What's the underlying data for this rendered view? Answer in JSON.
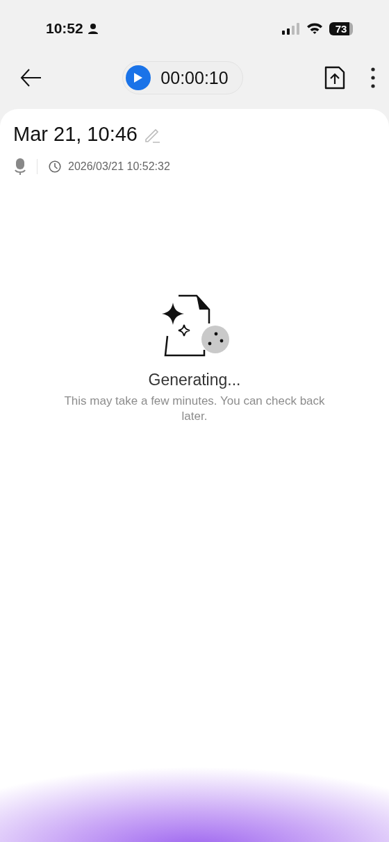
{
  "status_bar": {
    "time": "10:52",
    "battery": "73"
  },
  "toolbar": {
    "timer": "00:00:10"
  },
  "recording": {
    "title": "Mar 21, 10:46",
    "timestamp": "2026/03/21 10:52:32"
  },
  "empty_state": {
    "title": "Generating...",
    "message": "This may take a few minutes. You can check back later."
  }
}
